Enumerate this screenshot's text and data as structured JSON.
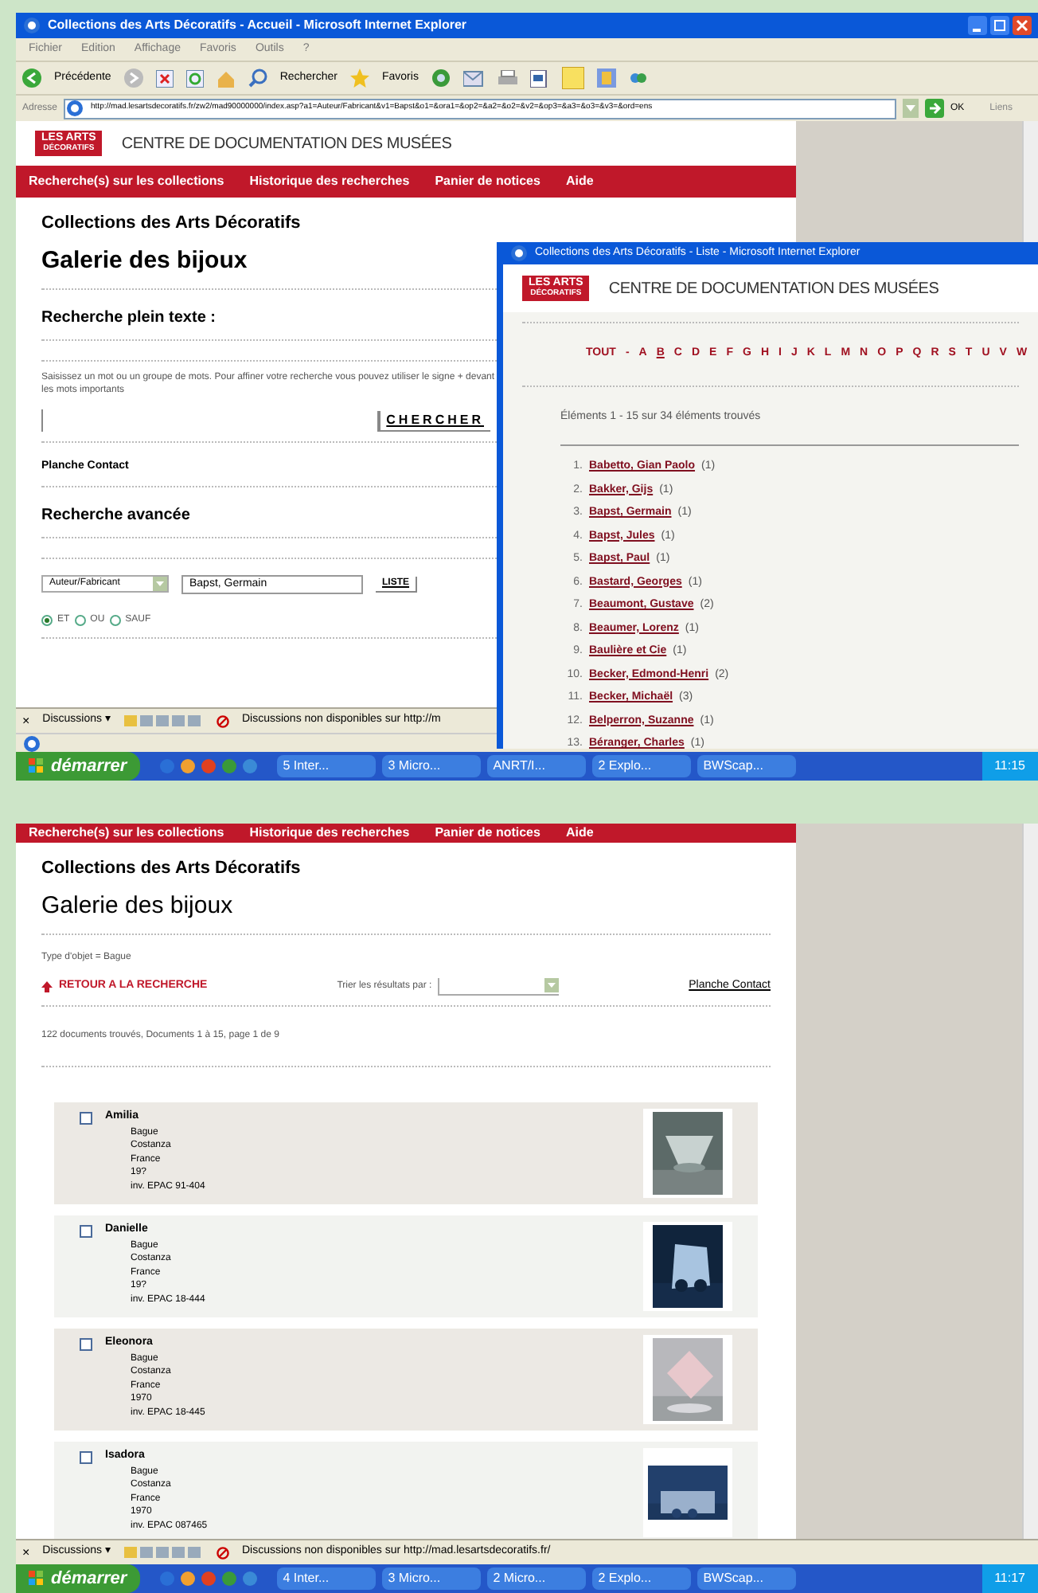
{
  "window_1": {
    "title": "Collections des Arts Décoratifs - Accueil - Microsoft Internet Explorer",
    "menu": [
      "Fichier",
      "Edition",
      "Affichage",
      "Favoris",
      "Outils",
      "?"
    ],
    "toolbar": [
      "Précédente",
      "Rechercher",
      "Favoris"
    ],
    "address_label": "Adresse",
    "url": "http://mad.lesartsdecoratifs.fr/zw2/mad90000000/index.asp?a1=Auteur/Fabricant&v1=Bapst&o1=&ora1=&op2=&a2=&o2=&v2=&op3=&a3=&o3=&v3=&ord=ens",
    "go": "OK",
    "links": "Liens",
    "site": {
      "logo": [
        "LES ARTS",
        "DÉCORATIFS"
      ],
      "heading": "CENTRE DE DOCUMENTATION DES MUSÉES",
      "nav": [
        "Recherche(s) sur les collections",
        "Historique des recherches",
        "Panier de notices",
        "Aide"
      ]
    },
    "page": {
      "collection": "Collections des Arts Décoratifs",
      "title": "Galerie des bijoux",
      "fulltext_heading": "Recherche plein texte :",
      "hint": "Saisissez un mot ou un groupe de mots. Pour affiner votre recherche vous pouvez utiliser le signe + devant les mots importants",
      "search_button": "CHERCHER",
      "contact": "Planche Contact",
      "advanced_heading": "Recherche avancée",
      "field_select": "Auteur/Fabricant",
      "field_value": "Bapst, Germain",
      "list_button": "LISTE",
      "operators": [
        {
          "label": "ET",
          "selected": true
        },
        {
          "label": "OU",
          "selected": false
        },
        {
          "label": "SAUF",
          "selected": false
        }
      ]
    },
    "discussions": {
      "close": "×",
      "label": "Discussions ▾",
      "message": "Discussions non disponibles sur http://m"
    }
  },
  "popup_window": {
    "title": "Collections des Arts Décoratifs - Liste - Microsoft Internet Explorer",
    "logo": [
      "LES ARTS",
      "DÉCORATIFS"
    ],
    "heading": "CENTRE DE DOCUMENTATION DES MUSÉES",
    "letters": [
      {
        "label": "TOUT",
        "selected": false
      },
      {
        "label": "-",
        "selected": false
      },
      {
        "label": "A",
        "selected": false
      },
      {
        "label": "B",
        "selected": true
      },
      {
        "label": "C",
        "selected": false
      },
      {
        "label": "D",
        "selected": false
      },
      {
        "label": "E",
        "selected": false
      },
      {
        "label": "F",
        "selected": false
      },
      {
        "label": "G",
        "selected": false
      },
      {
        "label": "H",
        "selected": false
      },
      {
        "label": "I",
        "selected": false
      },
      {
        "label": "J",
        "selected": false
      },
      {
        "label": "K",
        "selected": false
      },
      {
        "label": "L",
        "selected": false
      },
      {
        "label": "M",
        "selected": false
      },
      {
        "label": "N",
        "selected": false
      },
      {
        "label": "O",
        "selected": false
      },
      {
        "label": "P",
        "selected": false
      },
      {
        "label": "Q",
        "selected": false
      },
      {
        "label": "R",
        "selected": false
      },
      {
        "label": "S",
        "selected": false
      },
      {
        "label": "T",
        "selected": false
      },
      {
        "label": "U",
        "selected": false
      },
      {
        "label": "V",
        "selected": false
      },
      {
        "label": "W",
        "selected": false
      }
    ],
    "count": "Éléments 1 - 15 sur 34 éléments trouvés",
    "entries": [
      {
        "number": "1.",
        "name": "Babetto, Gian Paolo",
        "count": "(1)"
      },
      {
        "number": "2.",
        "name": "Bakker, Gijs",
        "count": "(1)"
      },
      {
        "number": "3.",
        "name": "Bapst, Germain",
        "count": "(1)"
      },
      {
        "number": "4.",
        "name": "Bapst, Jules",
        "count": "(1)"
      },
      {
        "number": "5.",
        "name": "Bapst, Paul",
        "count": "(1)"
      },
      {
        "number": "6.",
        "name": "Bastard, Georges",
        "count": "(1)"
      },
      {
        "number": "7.",
        "name": "Beaumont, Gustave",
        "count": "(2)"
      },
      {
        "number": "8.",
        "name": "Beaumer, Lorenz",
        "count": "(1)"
      },
      {
        "number": "9.",
        "name": "Baulière et Cie",
        "count": "(1)"
      },
      {
        "number": "10.",
        "name": "Becker, Edmond-Henri",
        "count": "(2)"
      },
      {
        "number": "11.",
        "name": "Becker, Michaël",
        "count": "(3)"
      },
      {
        "number": "12.",
        "name": "Belperron, Suzanne",
        "count": "(1)"
      },
      {
        "number": "13.",
        "name": "Béranger, Charles",
        "count": "(1)"
      }
    ]
  },
  "taskbar_1": {
    "start": "démarrer",
    "tasks": [
      "5 Inter...",
      "3 Micro...",
      "ANRT/I...",
      "2 Explo...",
      "BWScap..."
    ],
    "clock": "11:15"
  },
  "window_2": {
    "nav": [
      "Recherche(s) sur les collections",
      "Historique des recherches",
      "Panier de notices",
      "Aide"
    ],
    "collection": "Collections des Arts Décoratifs",
    "title": "Galerie des bijoux",
    "criteria": "Type d'objet = Bague",
    "back": "RETOUR A LA RECHERCHE",
    "sort_label": "Trier les résultats par :",
    "contact": "Planche Contact",
    "count": "122 documents trouvés, Documents 1 à 15, page 1 de 9",
    "results": [
      {
        "name": "Amilia",
        "lines": [
          "Bague",
          "Costanza",
          "France",
          "19?",
          "inv. EPAC 91-404"
        ],
        "checked": false
      },
      {
        "name": "Danielle",
        "lines": [
          "Bague",
          "Costanza",
          "France",
          "19?",
          "inv. EPAC 18-444"
        ],
        "checked": false
      },
      {
        "name": "Eleonora",
        "lines": [
          "Bague",
          "Costanza",
          "France",
          "1970",
          "inv. EPAC 18-445"
        ],
        "checked": false
      },
      {
        "name": "Isadora",
        "lines": [
          "Bague",
          "Costanza",
          "France",
          "1970",
          "inv. EPAC 087465"
        ],
        "checked": false
      }
    ],
    "discussions": {
      "close": "×",
      "label": "Discussions ▾",
      "message": "Discussions non disponibles sur http://mad.lesartsdecoratifs.fr/"
    }
  },
  "taskbar_2": {
    "start": "démarrer",
    "tasks": [
      "4 Inter...",
      "3 Micro...",
      "2 Micro...",
      "2 Explo...",
      "BWScap..."
    ],
    "clock": "11:17"
  }
}
